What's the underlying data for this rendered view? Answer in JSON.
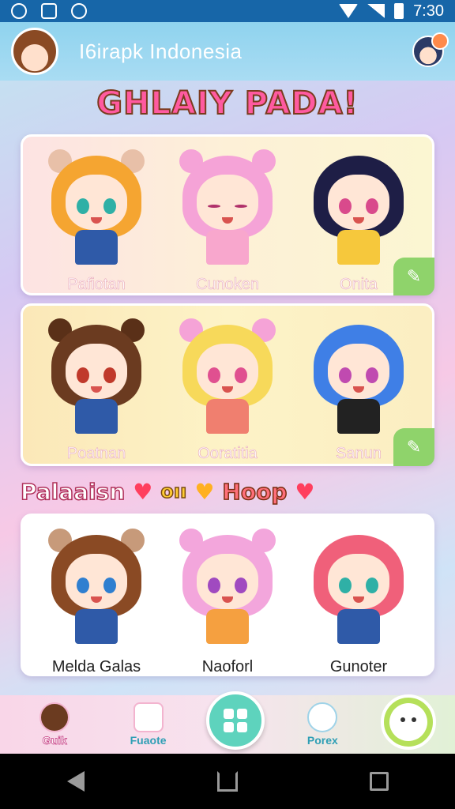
{
  "status_bar": {
    "time": "7:30"
  },
  "app_bar": {
    "title": "I6irapk Indonesia"
  },
  "heading": "GHLAIY PADA!",
  "card1": {
    "characters": [
      {
        "name": "Pafiotan",
        "hair": "#f5a531",
        "eyes": "#2fb0a6",
        "outfit": "#2f5aa8",
        "ears": "#e8c0a8"
      },
      {
        "name": "Cunoken",
        "hair": "#f5a3d7",
        "eyes": "#b0306a",
        "outfit": "#f8a7cd",
        "ears": "#f5a3d7"
      },
      {
        "name": "Onita",
        "hair": "#1e1e46",
        "eyes": "#d94a8c",
        "outfit": "#f6c83c",
        "ears": ""
      }
    ]
  },
  "card2": {
    "characters": [
      {
        "name": "Poatnan",
        "hair": "#6b3b20",
        "eyes": "#c0392b",
        "outfit": "#2f5aa8",
        "ears": "#5a3018"
      },
      {
        "name": "Ooratitia",
        "hair": "#f7d95a",
        "eyes": "#e05090",
        "outfit": "#f07f6f",
        "ears": "#f5a3d7"
      },
      {
        "name": "Sanun",
        "hair": "#3f7fe6",
        "eyes": "#c04ab0",
        "outfit": "#222222",
        "ears": ""
      }
    ]
  },
  "section": {
    "part1": "Palaaisn",
    "part2": "oıı",
    "part3": "Hoop"
  },
  "card3": {
    "characters": [
      {
        "name": "Melda Galas",
        "hair": "#8a4a24",
        "eyes": "#2f7fd0",
        "outfit": "#2f5aa8",
        "ears": "#c79a7a"
      },
      {
        "name": "Naoforl",
        "hair": "#f3a6dc",
        "eyes": "#a04ac0",
        "outfit": "#f5a040",
        "ears": "#f3a6dc"
      },
      {
        "name": "Gunoter",
        "hair": "#f0607a",
        "eyes": "#2fb0a6",
        "outfit": "#2f5aa8",
        "ears": ""
      }
    ]
  },
  "tabs": {
    "tab1": "Guik",
    "tab2": "Fuaote",
    "tab4": "Porex"
  },
  "colors": {
    "status_bar": "#1766a8",
    "app_bar": "#8fd3ee",
    "accent_pink": "#ff5aa0",
    "accent_green": "#8fd36b",
    "center_tab": "#5ed3bd"
  }
}
